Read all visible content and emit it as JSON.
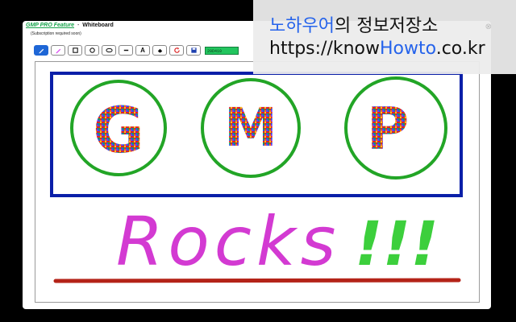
{
  "header": {
    "brand": "GMP PRO Feature",
    "separator": "-",
    "title": "Whiteboard",
    "subtitle": "(Subscription required soon)"
  },
  "toolbar": {
    "tools": [
      {
        "name": "pencil",
        "icon": "pencil-icon",
        "active": true
      },
      {
        "name": "marker",
        "icon": "marker-icon",
        "active": false
      },
      {
        "name": "rectangle",
        "icon": "square-icon",
        "active": false
      },
      {
        "name": "circle",
        "icon": "circle-icon",
        "active": false
      },
      {
        "name": "ellipse",
        "icon": "ellipse-icon",
        "active": false
      },
      {
        "name": "line",
        "icon": "line-icon",
        "active": false
      },
      {
        "name": "text",
        "icon": "text-icon",
        "label": "A",
        "active": false
      },
      {
        "name": "eraser",
        "icon": "eraser-icon",
        "active": false
      },
      {
        "name": "clear",
        "icon": "refresh-icon",
        "active": false
      },
      {
        "name": "save",
        "icon": "save-icon",
        "active": false
      }
    ],
    "color_value": "29D410",
    "color_hex": "#29D410"
  },
  "canvas": {
    "letters": [
      "G",
      "M",
      "P"
    ],
    "word": "Rocks",
    "exclaim": "!!!",
    "colors": {
      "box": "#0a1fa8",
      "circles": "#22a526",
      "word": "#d33ad2",
      "exclaim": "#3ccf3c",
      "underline": "#b42318"
    }
  },
  "overlay": {
    "line1_blue": "노하우어",
    "line1_dark": "의 정보저장소",
    "url_prefix": "https://know",
    "url_highlight": "Howto",
    "url_suffix": ".co.kr"
  }
}
